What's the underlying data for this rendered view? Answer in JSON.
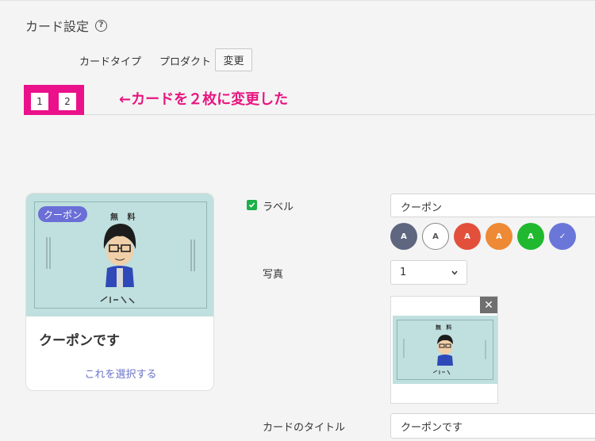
{
  "section": {
    "title": "カード設定",
    "help_glyph": "?"
  },
  "card_type": {
    "label": "カードタイプ",
    "value": "プロダクト",
    "change_button": "変更"
  },
  "tabs": [
    {
      "label": "1"
    },
    {
      "label": "2"
    }
  ],
  "annotation": {
    "text": "←カードを２枚に変更した",
    "color": "#e8157f"
  },
  "preview_card": {
    "badge": "クーポン",
    "image_heading": "無 料",
    "title": "クーポンです",
    "select_link": "これを選択する"
  },
  "label_field": {
    "checkbox_checked": true,
    "label": "ラベル",
    "value": "クーポン",
    "colors": [
      {
        "name": "dark-slate",
        "hex": "#5f6680",
        "glyph": "A"
      },
      {
        "name": "white",
        "hex": "#ffffff",
        "glyph": "A"
      },
      {
        "name": "red",
        "hex": "#e2503c",
        "glyph": "A"
      },
      {
        "name": "orange",
        "hex": "#ee8a35",
        "glyph": "A"
      },
      {
        "name": "green",
        "hex": "#20b82f",
        "glyph": "A"
      },
      {
        "name": "indigo-selected",
        "hex": "#6a76d8",
        "glyph": "✓"
      }
    ]
  },
  "photo_field": {
    "label": "写真",
    "selected": "1",
    "remove_glyph": "✕",
    "thumb_heading": "無 料"
  },
  "card_title_field": {
    "label": "カードのタイトル",
    "value": "クーポンです"
  }
}
